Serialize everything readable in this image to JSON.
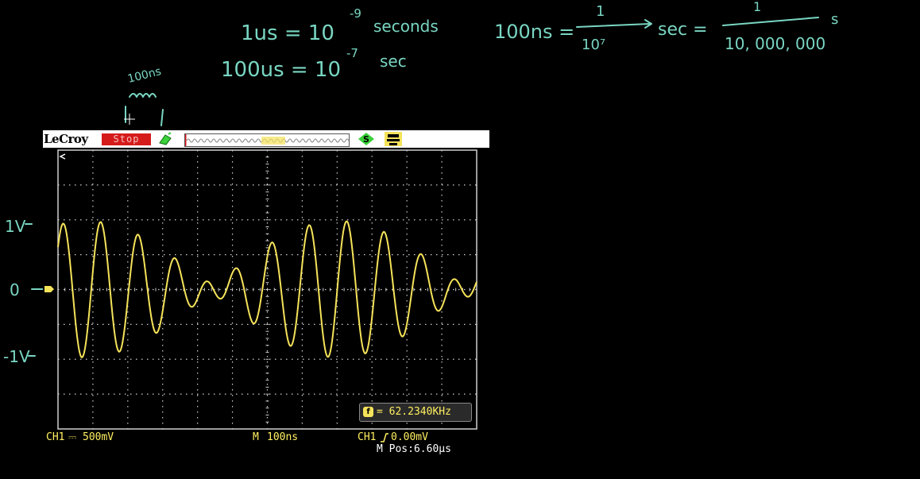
{
  "annotations": {
    "line1": "1us = 10",
    "line1_exp": "-9",
    "line1_unit": "seconds",
    "line2": "100us = 10",
    "line2_exp": "-7",
    "line2_unit": "sec",
    "eq_left": "100ns =",
    "frac1_num": "1",
    "frac1_den": "10⁷",
    "eq_mid": "sec =",
    "frac2_num": "1",
    "frac2_den": "10, 000, 000",
    "eq_unit": "s",
    "period_label": "100ns",
    "axis_1v": "1V",
    "axis_0": "0",
    "axis_neg1v": "-1V"
  },
  "scope": {
    "brand": "LeCroy",
    "run_state": "Stop",
    "ch1_scale_label": "CH1",
    "ch1_coupling": "⎓",
    "ch1_scale": "500mV",
    "timebase_prefix": "M",
    "timebase": "100ns",
    "trigger_label": "CH1",
    "trigger_level": "0.00mV",
    "mpos_label": "M Pos:6.60μs",
    "freq_glyph": "f",
    "freq_value": "= 62.2340KHz",
    "colors": {
      "trace": "#f5e35a",
      "grid": "#cfcfcf",
      "annotation": "#79d6c2",
      "stop_badge": "#d61b1b",
      "trig_icon": "#3ad13a"
    }
  }
}
